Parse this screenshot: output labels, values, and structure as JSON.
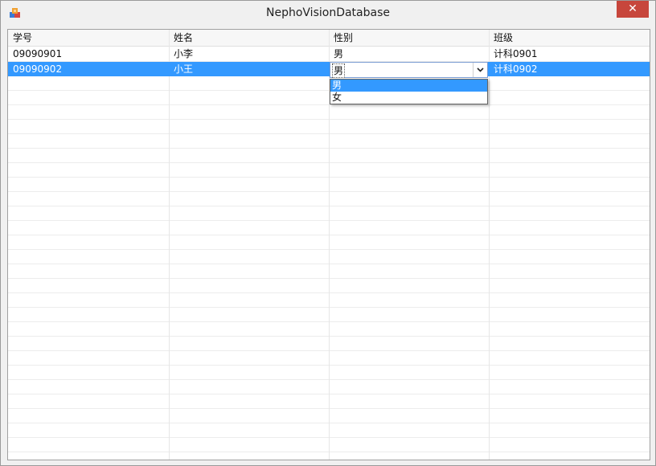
{
  "window": {
    "title": "NephoVisionDatabase",
    "close_label": "✕"
  },
  "grid": {
    "columns": [
      "学号",
      "姓名",
      "性别",
      "班级"
    ],
    "rows": [
      {
        "id": "09090901",
        "name": "小李",
        "gender": "男",
        "class": "计科0901"
      },
      {
        "id": "09090902",
        "name": "小王",
        "gender": "男",
        "class": "计科0902"
      }
    ],
    "selected_row": 1
  },
  "gender_editor": {
    "value": "男",
    "options": [
      "男",
      "女"
    ],
    "highlighted_option": "男"
  },
  "colors": {
    "selection": "#3399ff",
    "close_button": "#c7463c"
  }
}
